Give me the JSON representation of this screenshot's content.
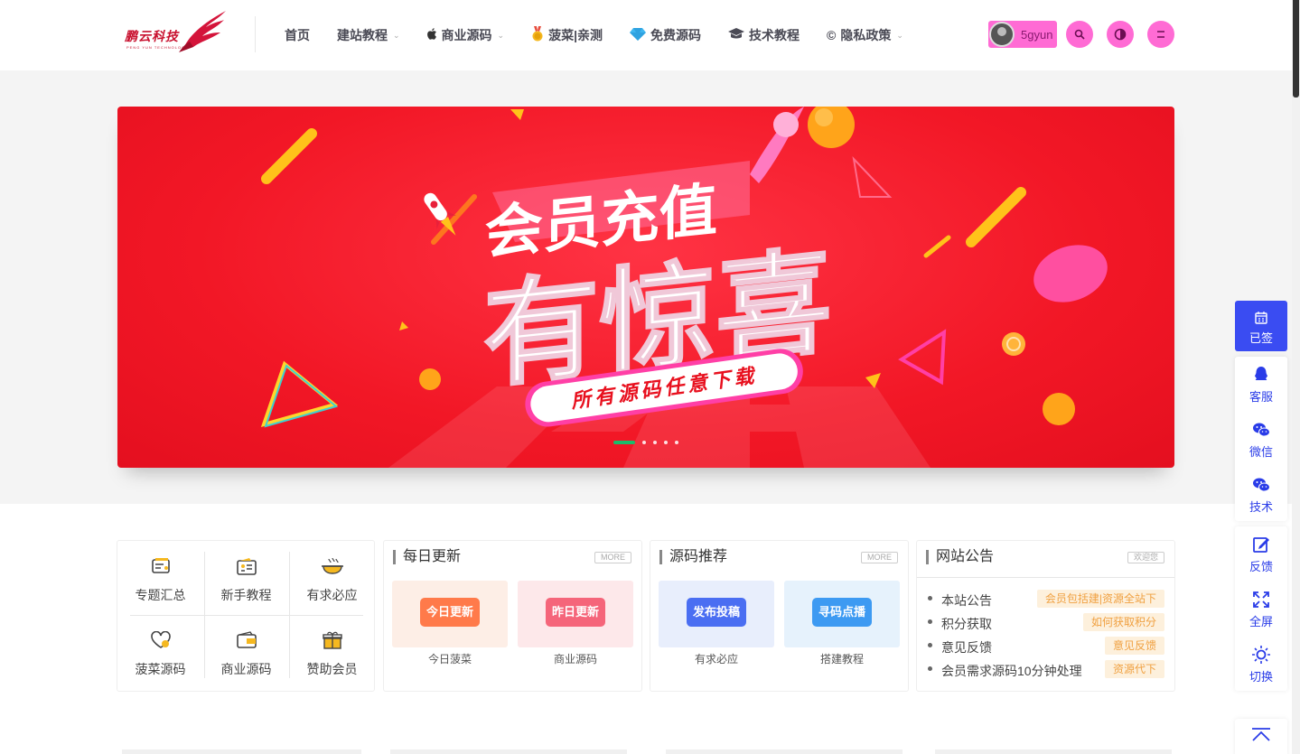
{
  "header": {
    "logo_text": "鹏云科技",
    "logo_sub": "PENG YUN TECHNOLOGY",
    "nav": [
      {
        "label": "首页",
        "icon": "",
        "dropdown": false
      },
      {
        "label": "建站教程",
        "icon": "",
        "dropdown": true
      },
      {
        "label": "商业源码",
        "icon": "apple-icon",
        "dropdown": true
      },
      {
        "label": "菠菜|亲测",
        "icon": "medal-icon",
        "dropdown": false
      },
      {
        "label": "免费源码",
        "icon": "diamond-icon",
        "dropdown": false
      },
      {
        "label": "技术教程",
        "icon": "graduation-cap-icon",
        "dropdown": false
      },
      {
        "label": "隐私政策",
        "icon": "copyright-icon",
        "dropdown": true
      }
    ],
    "username": "5gyun",
    "accent": "#ff6bd4"
  },
  "banner": {
    "headline": "会员充值",
    "headline_big": "有惊喜",
    "ribbon": "所有源码任意下载",
    "slides": 5,
    "active_slide": 1
  },
  "shortcuts": [
    {
      "label": "专题汇总",
      "icon": "topic-icon"
    },
    {
      "label": "新手教程",
      "icon": "tutorial-icon"
    },
    {
      "label": "有求必应",
      "icon": "bowl-icon"
    },
    {
      "label": "菠菜源码",
      "icon": "heart-icon"
    },
    {
      "label": "商业源码",
      "icon": "wallet-icon"
    },
    {
      "label": "赞助会员",
      "icon": "gift-icon"
    }
  ],
  "daily": {
    "title": "每日更新",
    "more": "MORE",
    "items": [
      {
        "badge": "今日更新",
        "label": "今日菠菜"
      },
      {
        "badge": "昨日更新",
        "label": "商业源码"
      }
    ]
  },
  "recommend": {
    "title": "源码推荐",
    "more": "MORE",
    "items": [
      {
        "badge": "发布投稿",
        "label": "有求必应"
      },
      {
        "badge": "寻码点播",
        "label": "搭建教程"
      }
    ]
  },
  "notice": {
    "title": "网站公告",
    "welcome": "欢迎您",
    "rows": [
      {
        "text": "本站公告",
        "tag": "会员包括建|资源全站下"
      },
      {
        "text": "积分获取",
        "tag": "如何获取积分"
      },
      {
        "text": "意见反馈",
        "tag": "意见反馈"
      },
      {
        "text": "会员需求源码10分钟处理",
        "tag": "资源代下"
      }
    ]
  },
  "side": {
    "signin": "已签",
    "items": [
      "客服",
      "微信",
      "技术",
      "反馈",
      "全屏",
      "切换"
    ],
    "accent": "#2a3ce8"
  }
}
